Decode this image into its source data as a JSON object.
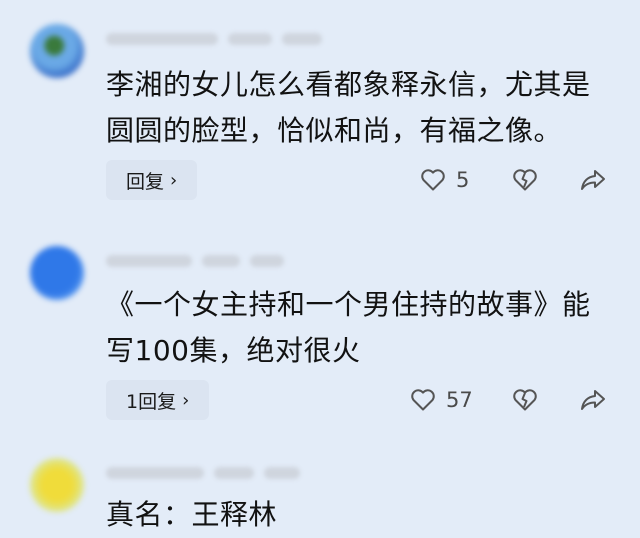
{
  "comments": [
    {
      "text_lines": [
        "李湘的女儿怎么看都象释永信，尤其是",
        "圆圆的脸型，恰似和尚，有福之像。"
      ],
      "reply_label": "回复",
      "likes": "5",
      "avatar_color": "#4a8fd6"
    },
    {
      "text_lines": [
        "《一个女主持和一个男住持的故事》能",
        "写100集，绝对很火"
      ],
      "reply_label": "1回复",
      "likes": "57",
      "avatar_color": "#3b82e6"
    },
    {
      "text_lines": [
        "真名：王释林"
      ],
      "avatar_color": "#e8d850"
    }
  ],
  "icons": {
    "like": "heart-outline-icon",
    "dislike": "broken-heart-icon",
    "share": "share-arrow-icon",
    "chevron": "chevron-right-icon"
  },
  "glyphs": {
    "chevron": "›"
  }
}
